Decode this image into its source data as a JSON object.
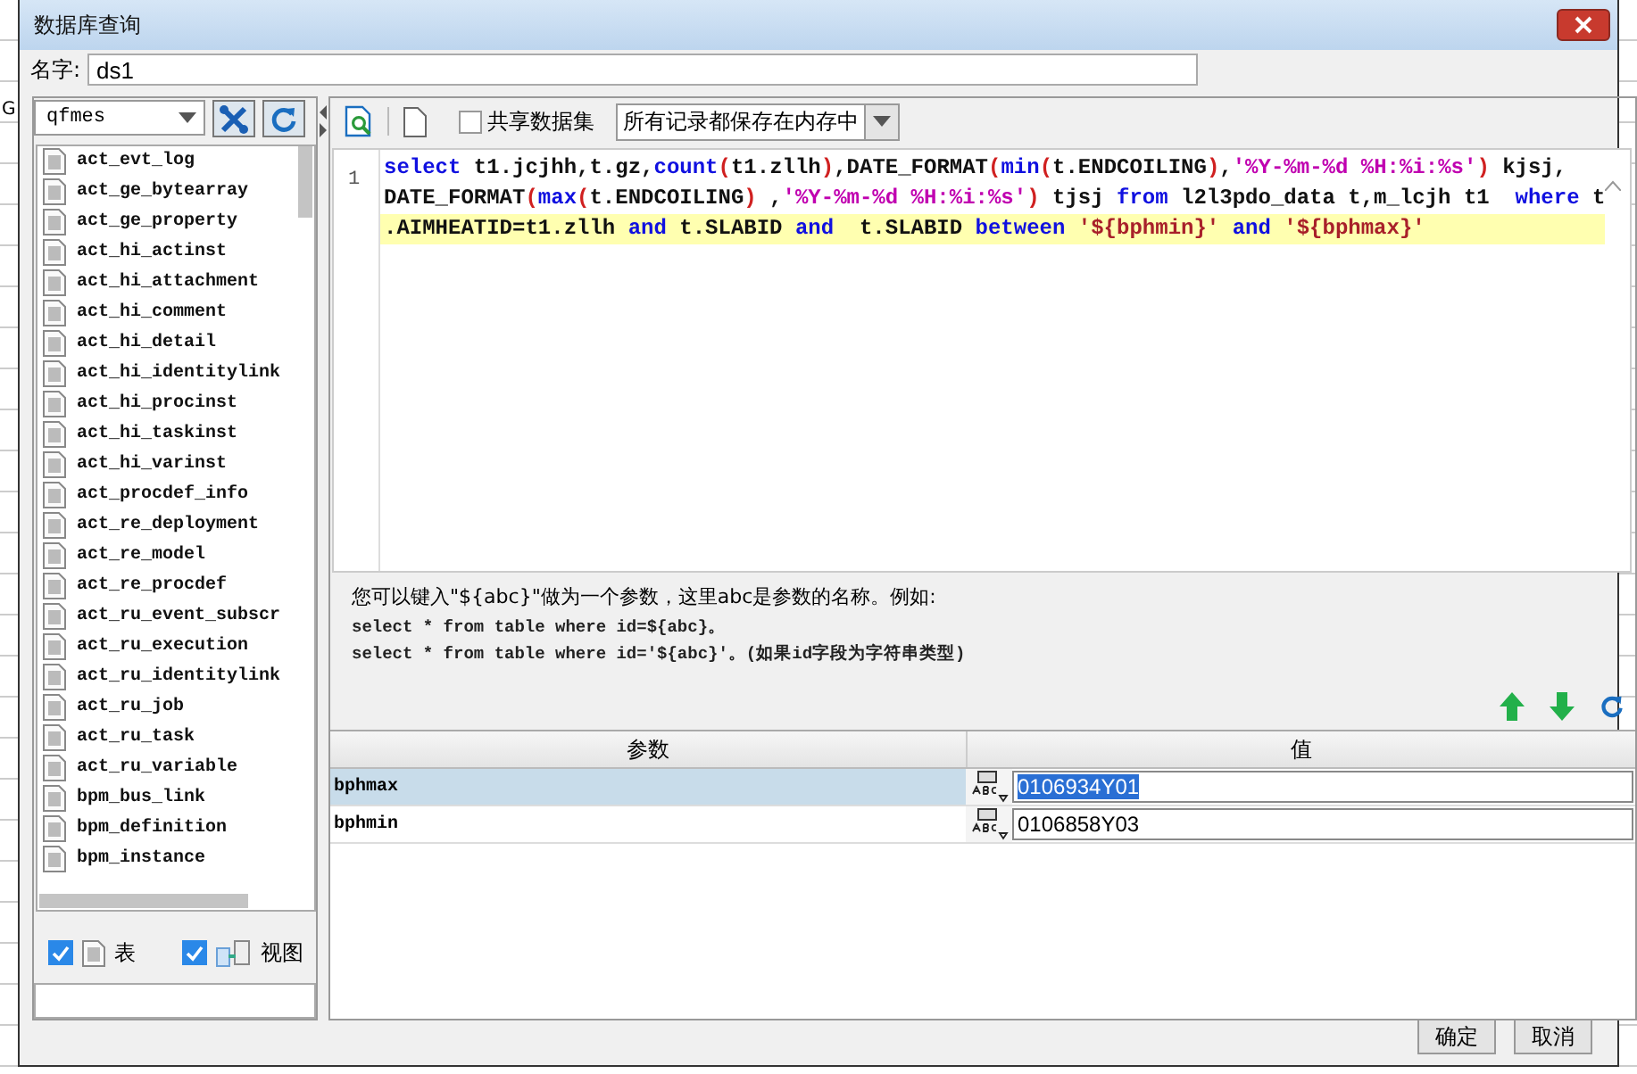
{
  "background": {
    "cell_text": "G"
  },
  "window": {
    "title": "数据库查询"
  },
  "name_field": {
    "label": "名字:",
    "value": "ds1"
  },
  "datasource": {
    "value": "qfmes"
  },
  "tables": [
    "act_evt_log",
    "act_ge_bytearray",
    "act_ge_property",
    "act_hi_actinst",
    "act_hi_attachment",
    "act_hi_comment",
    "act_hi_detail",
    "act_hi_identitylink",
    "act_hi_procinst",
    "act_hi_taskinst",
    "act_hi_varinst",
    "act_procdef_info",
    "act_re_deployment",
    "act_re_model",
    "act_re_procdef",
    "act_ru_event_subscr",
    "act_ru_execution",
    "act_ru_identitylink",
    "act_ru_job",
    "act_ru_task",
    "act_ru_variable",
    "bpm_bus_link",
    "bpm_definition",
    "bpm_instance"
  ],
  "filters": [
    {
      "label": "表",
      "checked": true,
      "kind": "table"
    },
    {
      "label": "视图",
      "checked": true,
      "kind": "view"
    }
  ],
  "toolbar": {
    "share_checkbox": {
      "label": "共享数据集",
      "checked": false
    },
    "storage_mode": "所有记录都保存在内存中"
  },
  "editor": {
    "line_number": "1",
    "rows": [
      {
        "highlighted": false,
        "tokens": [
          {
            "kind": "kw",
            "text": "select"
          },
          {
            "kind": "plain",
            "text": " t1.jcjhh,t.gz,"
          },
          {
            "kind": "kw",
            "text": "count"
          },
          {
            "kind": "paren",
            "text": "("
          },
          {
            "kind": "plain",
            "text": "t1.zllh"
          },
          {
            "kind": "paren",
            "text": ")"
          },
          {
            "kind": "plain",
            "text": ",DATE_FORMAT"
          },
          {
            "kind": "paren",
            "text": "("
          },
          {
            "kind": "kw",
            "text": "min"
          },
          {
            "kind": "paren",
            "text": "("
          },
          {
            "kind": "plain",
            "text": "t.ENDCOILING"
          },
          {
            "kind": "paren",
            "text": ")"
          },
          {
            "kind": "plain",
            "text": ","
          },
          {
            "kind": "str",
            "text": "'%Y-%m-%d %H:%i:%s'"
          },
          {
            "kind": "paren",
            "text": ")"
          },
          {
            "kind": "plain",
            "text": " kjsj,"
          }
        ]
      },
      {
        "highlighted": false,
        "tokens": [
          {
            "kind": "plain",
            "text": "DATE_FORMAT"
          },
          {
            "kind": "paren",
            "text": "("
          },
          {
            "kind": "kw",
            "text": "max"
          },
          {
            "kind": "paren",
            "text": "("
          },
          {
            "kind": "plain",
            "text": "t.ENDCOILING"
          },
          {
            "kind": "paren",
            "text": ")"
          },
          {
            "kind": "plain",
            "text": " ,"
          },
          {
            "kind": "str",
            "text": "'%Y-%m-%d %H:%i:%s'"
          },
          {
            "kind": "paren",
            "text": ")"
          },
          {
            "kind": "plain",
            "text": " tjsj "
          },
          {
            "kind": "kw",
            "text": "from"
          },
          {
            "kind": "plain",
            "text": " l2l3pdo_data t,m_lcjh t1  "
          },
          {
            "kind": "kw",
            "text": "where"
          },
          {
            "kind": "plain",
            "text": " t"
          }
        ]
      },
      {
        "highlighted": true,
        "tokens": [
          {
            "kind": "plain",
            "text": ".AIMHEATID=t1.zllh "
          },
          {
            "kind": "kw",
            "text": "and"
          },
          {
            "kind": "plain",
            "text": " t.SLABID "
          },
          {
            "kind": "kw",
            "text": "and"
          },
          {
            "kind": "plain",
            "text": "  t.SLABID "
          },
          {
            "kind": "kw",
            "text": "between"
          },
          {
            "kind": "param",
            "text": " '${bphmin}'"
          },
          {
            "kind": "kw",
            "text": " and"
          },
          {
            "kind": "param",
            "text": " '${bphmax}'"
          }
        ]
      }
    ]
  },
  "help": [
    "您可以键入\"${abc}\"做为一个参数，这里abc是参数的名称。例如:",
    "select * from table where id=${abc}。",
    "select * from table where id='${abc}'。(如果id字段为字符串类型)"
  ],
  "params": {
    "columns": [
      "参数",
      "值"
    ],
    "rows": [
      {
        "name": "bphmax",
        "value": "0106934Y01",
        "selected": true
      },
      {
        "name": "bphmin",
        "value": "0106858Y03",
        "selected": false
      }
    ]
  },
  "buttons": [
    "确定",
    "取消"
  ]
}
